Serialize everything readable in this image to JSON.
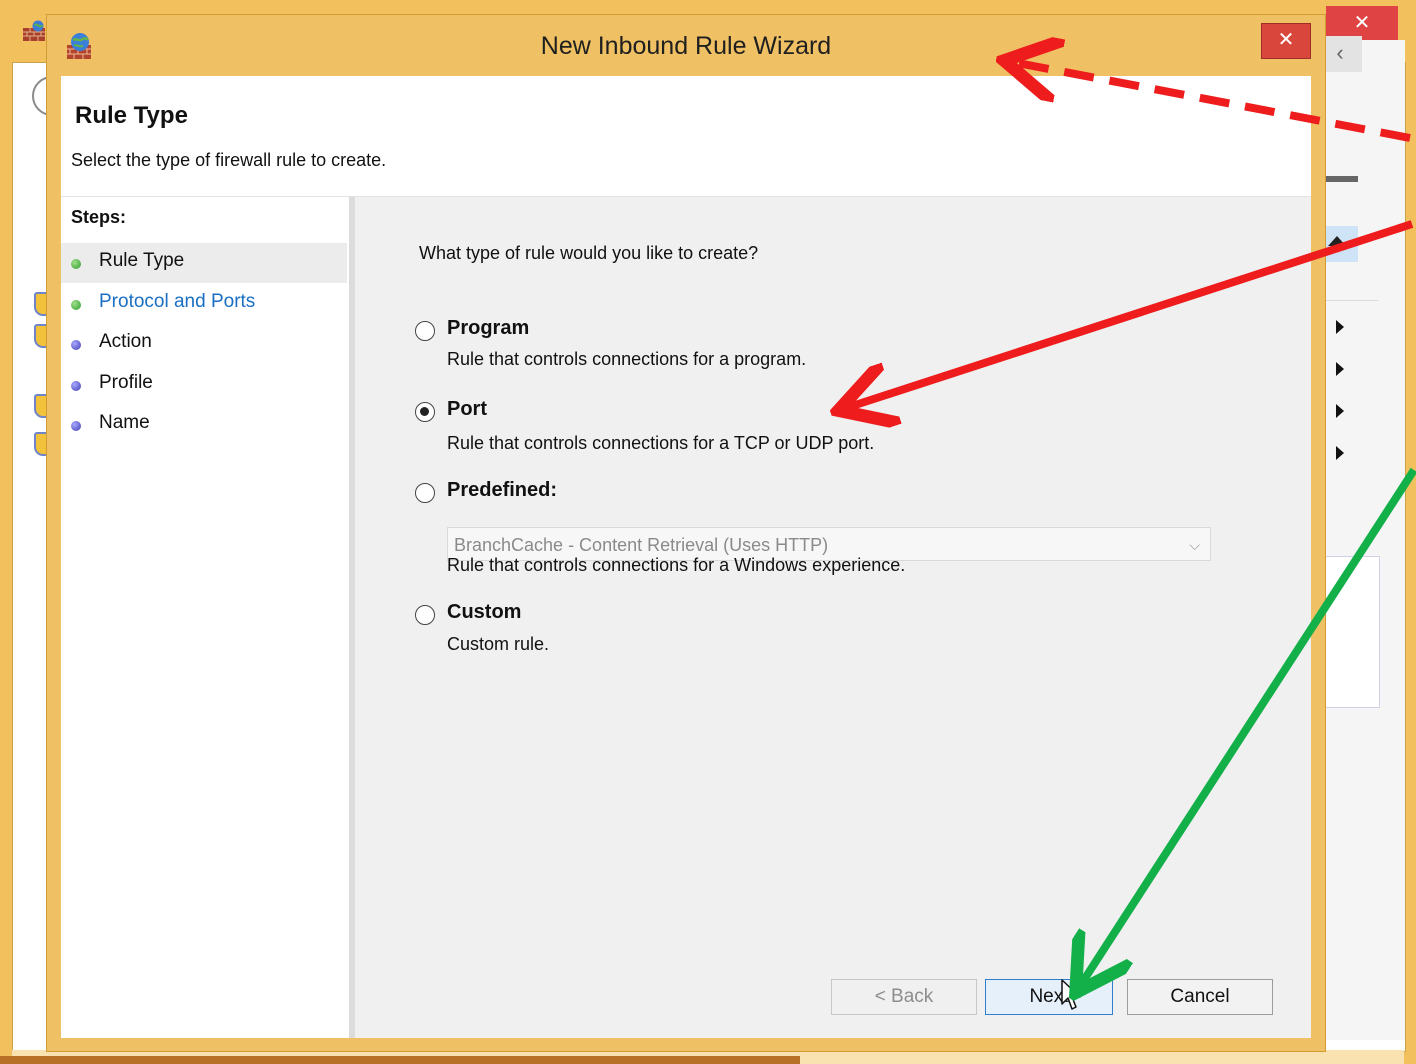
{
  "wizard": {
    "title": "New Inbound Rule Wizard",
    "close_glyph": "✕",
    "header": {
      "title": "Rule Type",
      "subtitle": "Select the type of firewall rule to create."
    },
    "steps": {
      "heading": "Steps:",
      "items": [
        {
          "label": "Rule Type",
          "dot": "green"
        },
        {
          "label": "Protocol and Ports",
          "dot": "green"
        },
        {
          "label": "Action",
          "dot": "blue"
        },
        {
          "label": "Profile",
          "dot": "blue"
        },
        {
          "label": "Name",
          "dot": "blue"
        }
      ]
    },
    "question": "What type of rule would you like to create?",
    "options": [
      {
        "label": "Program",
        "desc": "Rule that controls connections for a program.",
        "selected": false
      },
      {
        "label": "Port",
        "desc": "Rule that controls connections for a TCP or UDP port.",
        "selected": true
      },
      {
        "label": "Predefined:",
        "desc": "Rule that controls connections for a Windows experience.",
        "selected": false
      },
      {
        "label": "Custom",
        "desc": "Custom rule.",
        "selected": false
      }
    ],
    "predefined_select": {
      "value": "BranchCache - Content Retrieval (Uses HTTP)",
      "enabled": false
    },
    "buttons": {
      "back": "< Back",
      "next": "Next",
      "cancel": "Cancel"
    }
  },
  "background_window": {
    "close_glyph": "✕",
    "nav_chevron": "‹"
  },
  "colors": {
    "window_frame": "#efc164",
    "close_red": "#d9473c",
    "annotation_red": "#ee1c1c",
    "annotation_green": "#13b04a",
    "link_blue": "#1a6fc4"
  },
  "icons": {
    "wizard": "firewall-globe-icon",
    "steps_current": "green-dot-icon",
    "steps_pending": "blue-dot-icon",
    "dropdown": "chevron-down-icon",
    "pointer": "mouse-cursor-icon"
  }
}
